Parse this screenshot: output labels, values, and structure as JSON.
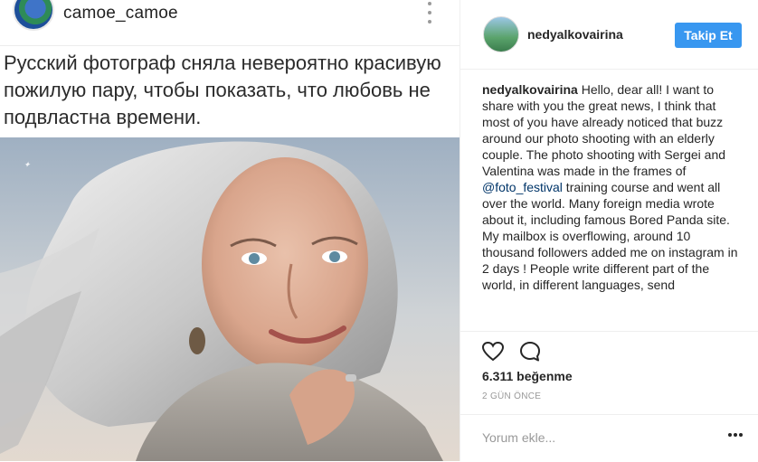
{
  "source_post": {
    "username": "camoe_camoe",
    "caption": "Русский фотограф сняла невероятно красивую пожилую пару, чтобы показать, что любовь не подвластна времени."
  },
  "post": {
    "username": "nedyalkovairina",
    "follow_label": "Takip Et",
    "comment_author": "nedyalkovairina",
    "comment_part1": " Hello, dear all! I want to share with you the great news, I think that most of you have already noticed that buzz around our photo shooting with an elderly couple. The photo shooting with Sergei and Valentina was made in the frames of ",
    "comment_mention": "@foto_festival",
    "comment_part2": " training course and went all over the world. Many foreign media wrote about it, including famous Bored Panda site. My mailbox is overflowing, around 10 thousand followers added me on instagram in 2 days ! People write different part of the world, in different languages, send",
    "likes": "6.311 beğenme",
    "timestamp": "2 GÜN ÖNCE",
    "comment_placeholder": "Yorum ekle..."
  },
  "icons": {
    "like": "heart-icon",
    "comment": "comment-bubble-icon",
    "more": "more-options-icon"
  },
  "colors": {
    "follow_button": "#3897f0",
    "mention": "#003569",
    "muted": "#999999"
  }
}
